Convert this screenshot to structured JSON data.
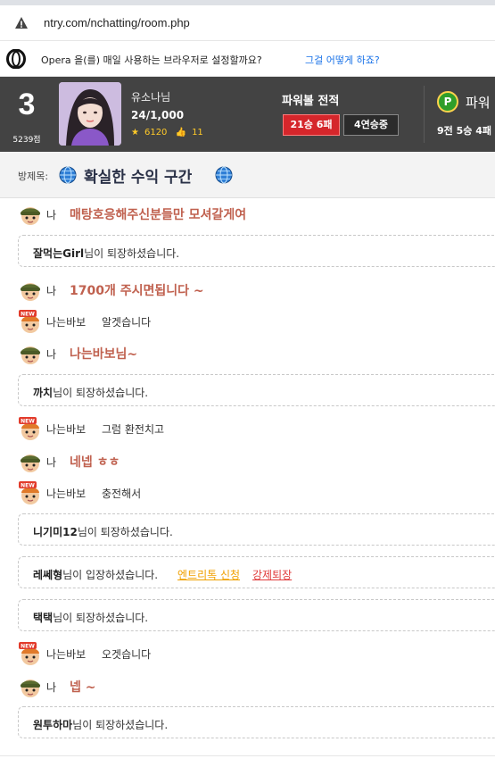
{
  "browser": {
    "url": "ntry.com/nchatting/room.php"
  },
  "opera_bar": {
    "message": "Opera 을(를) 매일 사용하는 브라우저로 설정할까요?",
    "link": "그걸 어떻게 하죠?"
  },
  "profile": {
    "rank": "3",
    "points": "5239점",
    "name": "유소나님",
    "count": "24/1,000",
    "stars": "6120",
    "likes": "11",
    "powerball_title": "파워볼 전적",
    "record_badge": "21승 6패",
    "streak_badge": "4연승중",
    "powerball_label": "파워",
    "powerball_record": "9전 5승 4패"
  },
  "room": {
    "label": "방제목:",
    "title": "확실한 수익 구간"
  },
  "messages": [
    {
      "type": "me",
      "who": "나",
      "text": "매탕호응해주신분들만 모셔갈게여"
    },
    {
      "type": "system",
      "name": "잘먹는Girl",
      "suffix": "님이 퇴장하셨습니다."
    },
    {
      "type": "me",
      "who": "나",
      "text": "1700개 주시면됩니다 ~"
    },
    {
      "type": "other",
      "who": "나는바보",
      "text": "알겟습니다"
    },
    {
      "type": "me",
      "who": "나",
      "text": "나는바보님~"
    },
    {
      "type": "system",
      "name": "까치",
      "suffix": "님이 퇴장하셨습니다."
    },
    {
      "type": "other",
      "who": "나는바보",
      "text": "그럼 환전치고"
    },
    {
      "type": "me",
      "who": "나",
      "text": "네넵 ㅎㅎ"
    },
    {
      "type": "other",
      "who": "나는바보",
      "text": "충전해서"
    },
    {
      "type": "system",
      "name": "니기미12",
      "suffix": "님이 퇴장하셨습니다."
    },
    {
      "type": "system",
      "name": "레쎄형",
      "suffix": "님이 입장하셨습니다.",
      "link1": "엔트리톡 신청",
      "link2": "강제퇴장"
    },
    {
      "type": "system",
      "name": "택택",
      "suffix": "님이 퇴장하셨습니다."
    },
    {
      "type": "other",
      "who": "나는바보",
      "text": "오겟습니다"
    },
    {
      "type": "me",
      "who": "나",
      "text": "넵 ~"
    },
    {
      "type": "system",
      "name": "원투하마",
      "suffix": "님이 퇴장하셨습니다."
    }
  ],
  "colors": {
    "profile_bg": "#434343",
    "me_text": "#c0614f",
    "badge_red": "#d5262b",
    "link_blue": "#1a73e8",
    "entry_link": "#f0a000",
    "kick_link": "#e03a3a"
  }
}
